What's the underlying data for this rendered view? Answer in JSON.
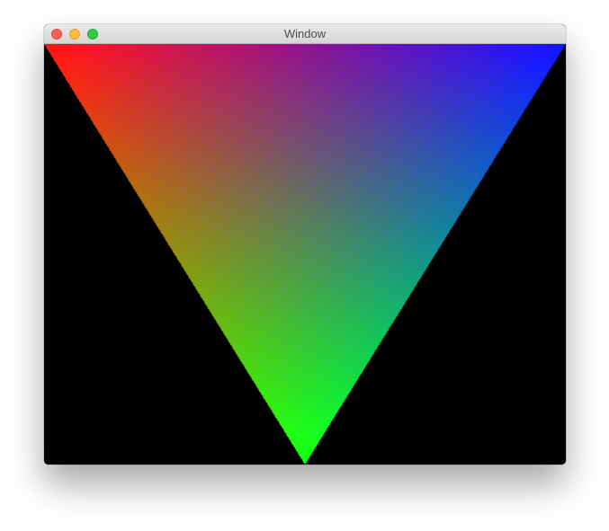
{
  "window": {
    "title": "Window",
    "controls": {
      "close": "close-button",
      "minimize": "minimize-button",
      "zoom": "zoom-button"
    }
  },
  "scene": {
    "background_color": "#000000",
    "vertex_colors": {
      "top_left": "#ff0000",
      "top_right": "#0000ff",
      "bottom": "#00ff00"
    }
  }
}
